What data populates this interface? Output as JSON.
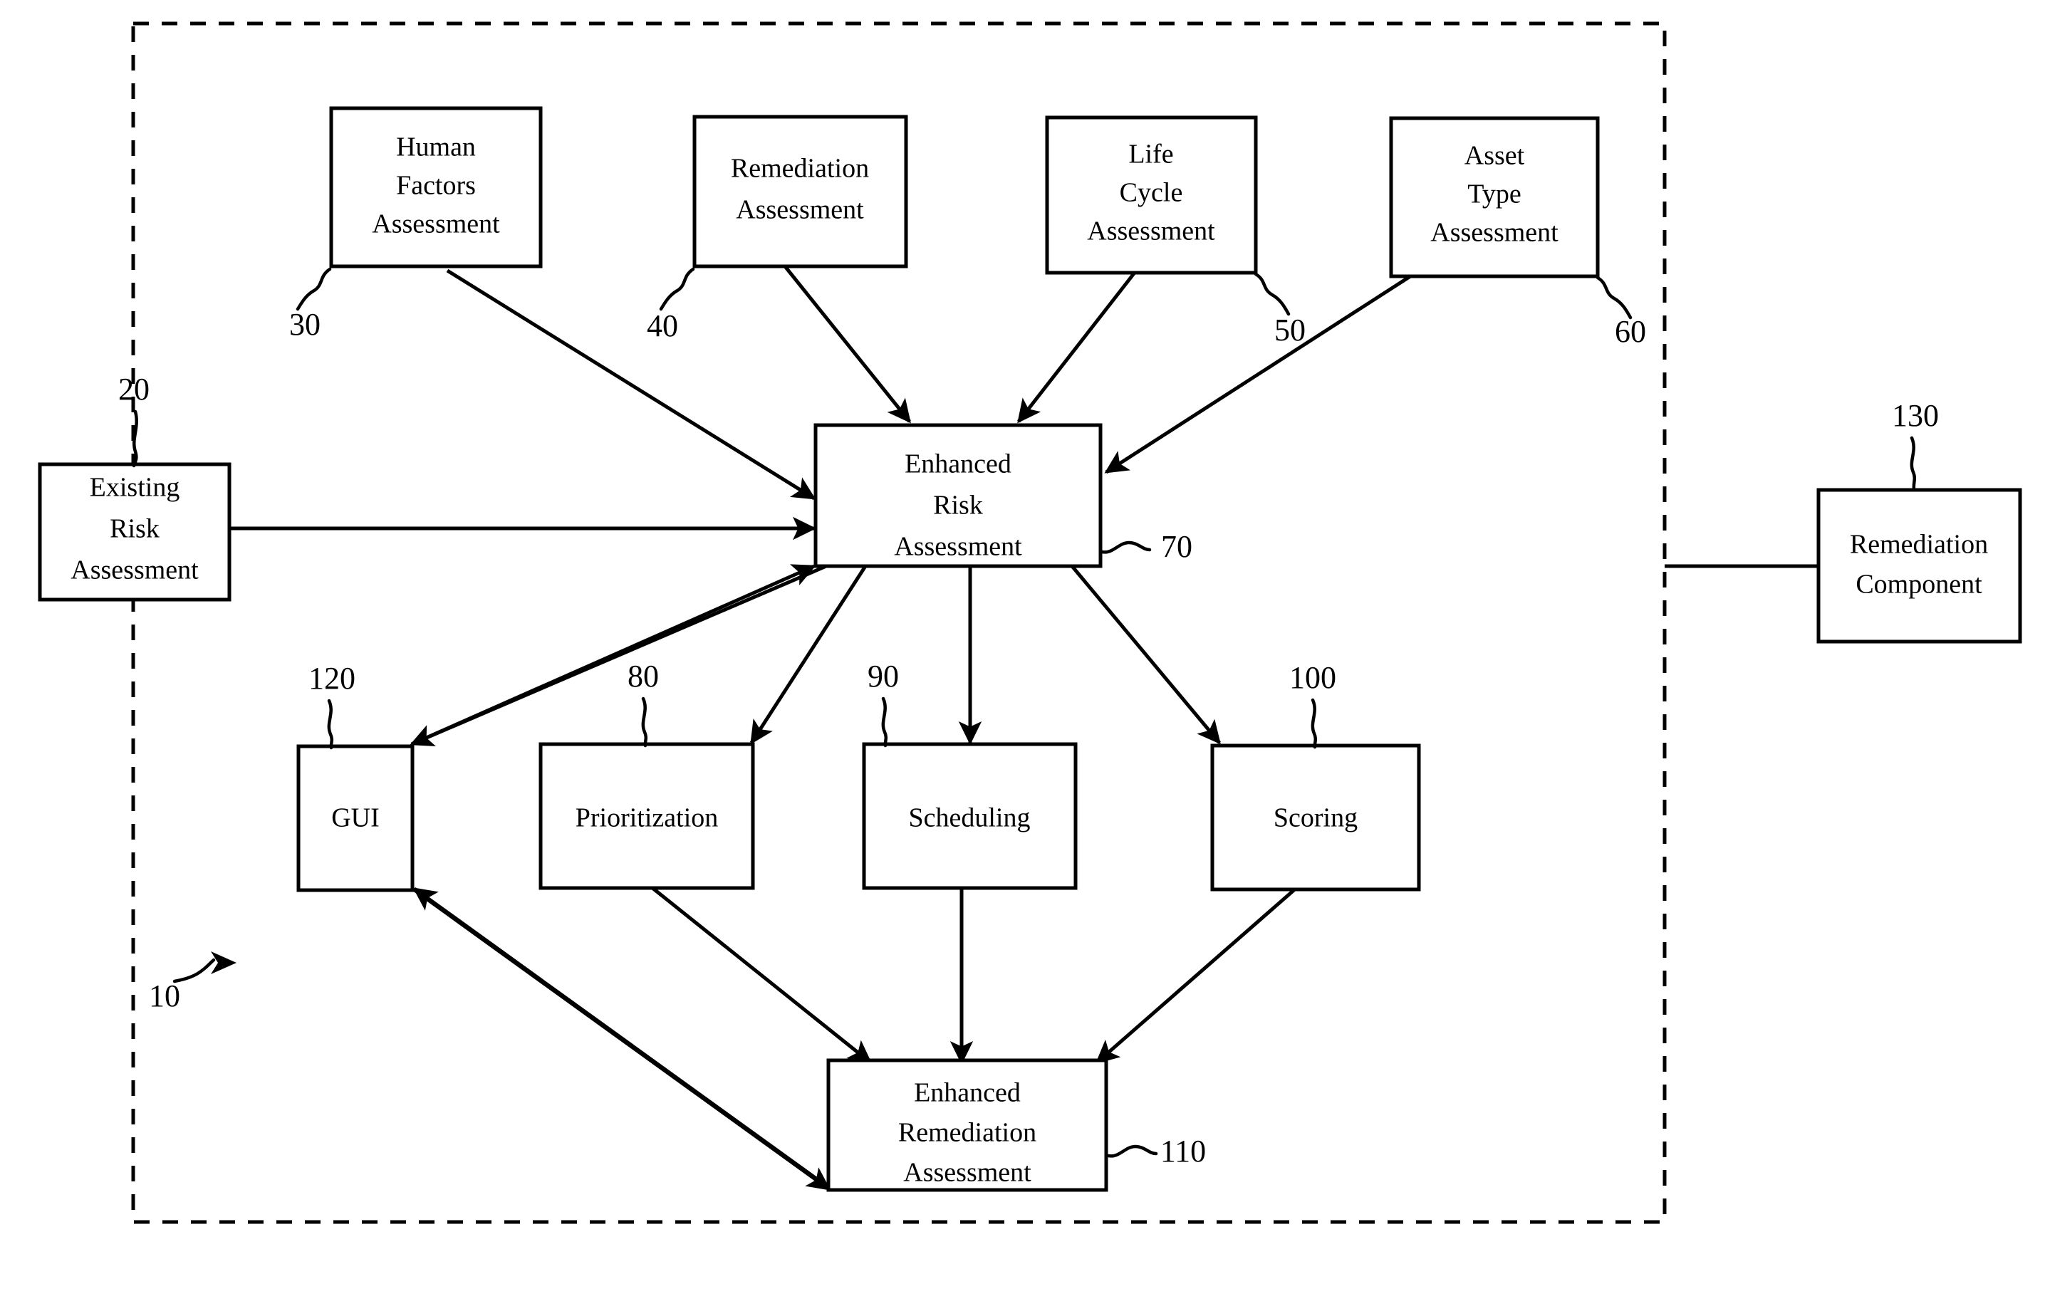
{
  "figure": {
    "kind": "patent-block-diagram",
    "system_boundary_ref": "10",
    "line_color": "#000000",
    "background_color": "#ffffff"
  },
  "boxes": {
    "existing_risk_assessment": {
      "ref": "20",
      "lines": [
        "Existing",
        "Risk",
        "Assessment"
      ]
    },
    "human_factors_assessment": {
      "ref": "30",
      "lines": [
        "Human",
        "Factors",
        "Assessment"
      ]
    },
    "remediation_assessment": {
      "ref": "40",
      "lines": [
        "Remediation",
        "Assessment"
      ]
    },
    "life_cycle_assessment": {
      "ref": "50",
      "lines": [
        "Life",
        "Cycle",
        "Assessment"
      ]
    },
    "asset_type_assessment": {
      "ref": "60",
      "lines": [
        "Asset",
        "Type",
        "Assessment"
      ]
    },
    "enhanced_risk_assessment": {
      "ref": "70",
      "lines": [
        "Enhanced",
        "Risk",
        "Assessment"
      ]
    },
    "prioritization": {
      "ref": "80",
      "lines": [
        "Prioritization"
      ]
    },
    "scheduling": {
      "ref": "90",
      "lines": [
        "Scheduling"
      ]
    },
    "scoring": {
      "ref": "100",
      "lines": [
        "Scoring"
      ]
    },
    "enhanced_remediation_assessment": {
      "ref": "110",
      "lines": [
        "Enhanced",
        "Remediation",
        "Assessment"
      ]
    },
    "gui": {
      "ref": "120",
      "lines": [
        "GUI"
      ]
    },
    "remediation_component": {
      "ref": "130",
      "lines": [
        "Remediation",
        "Component"
      ]
    }
  },
  "labels": {
    "era_l1": "Enhanced",
    "era_l2": "Risk",
    "era_l3": "Assessment",
    "erema_l1": "Enhanced",
    "erema_l2": "Remediation",
    "erema_l3": "Assessment",
    "exra_l1": "Existing",
    "exra_l2": "Risk",
    "exra_l3": "Assessment",
    "hfa_l1": "Human",
    "hfa_l2": "Factors",
    "hfa_l3": "Assessment",
    "ra_l1": "Remediation",
    "ra_l2": "Assessment",
    "lca_l1": "Life",
    "lca_l2": "Cycle",
    "lca_l3": "Assessment",
    "ata_l1": "Asset",
    "ata_l2": "Type",
    "ata_l3": "Assessment",
    "rc_l1": "Remediation",
    "rc_l2": "Component",
    "gui_l1": "GUI",
    "prio_l1": "Prioritization",
    "sched_l1": "Scheduling",
    "score_l1": "Scoring"
  },
  "refs": {
    "system": "10",
    "existing_risk": "20",
    "human_factors": "30",
    "remediation_assessment": "40",
    "life_cycle": "50",
    "asset_type": "60",
    "enhanced_risk": "70",
    "prioritization": "80",
    "scheduling": "90",
    "scoring": "100",
    "enhanced_remediation": "110",
    "gui": "120",
    "remediation_component": "130"
  }
}
